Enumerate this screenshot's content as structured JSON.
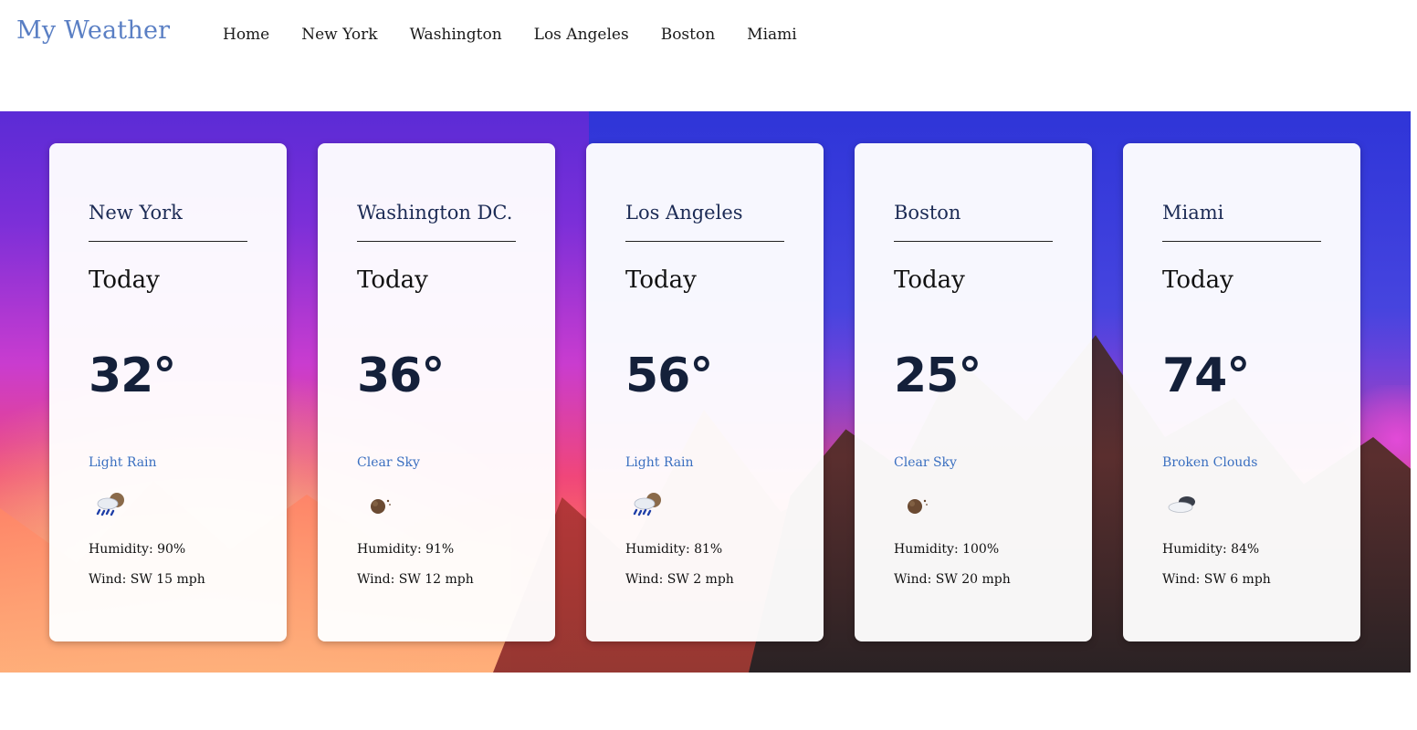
{
  "header": {
    "brand": "My Weather",
    "nav": [
      "Home",
      "New York",
      "Washington",
      "Los Angeles",
      "Boston",
      "Miami"
    ]
  },
  "cards": [
    {
      "city": "New York",
      "day": "Today",
      "temp": "32°",
      "condition": "Light Rain",
      "icon": "rain-cloud-icon",
      "humidity": "Humidity: 90%",
      "wind": "Wind: SW 15 mph"
    },
    {
      "city": "Washington DC.",
      "day": "Today",
      "temp": "36°",
      "condition": "Clear Sky",
      "icon": "clear-night-icon",
      "humidity": "Humidity: 91%",
      "wind": "Wind: SW 12 mph"
    },
    {
      "city": "Los Angeles",
      "day": "Today",
      "temp": "56°",
      "condition": "Light Rain",
      "icon": "rain-cloud-icon",
      "humidity": "Humidity: 81%",
      "wind": "Wind: SW 2 mph"
    },
    {
      "city": "Boston",
      "day": "Today",
      "temp": "25°",
      "condition": "Clear Sky",
      "icon": "clear-night-icon",
      "humidity": "Humidity: 100%",
      "wind": "Wind: SW 20 mph"
    },
    {
      "city": "Miami",
      "day": "Today",
      "temp": "74°",
      "condition": "Broken Clouds",
      "icon": "broken-clouds-icon",
      "humidity": "Humidity: 84%",
      "wind": "Wind: SW 6 mph"
    }
  ],
  "colors": {
    "brand": "#5a7fc4",
    "condition": "#3a6fc0",
    "city": "#1c2b55",
    "temp": "#14203a"
  }
}
